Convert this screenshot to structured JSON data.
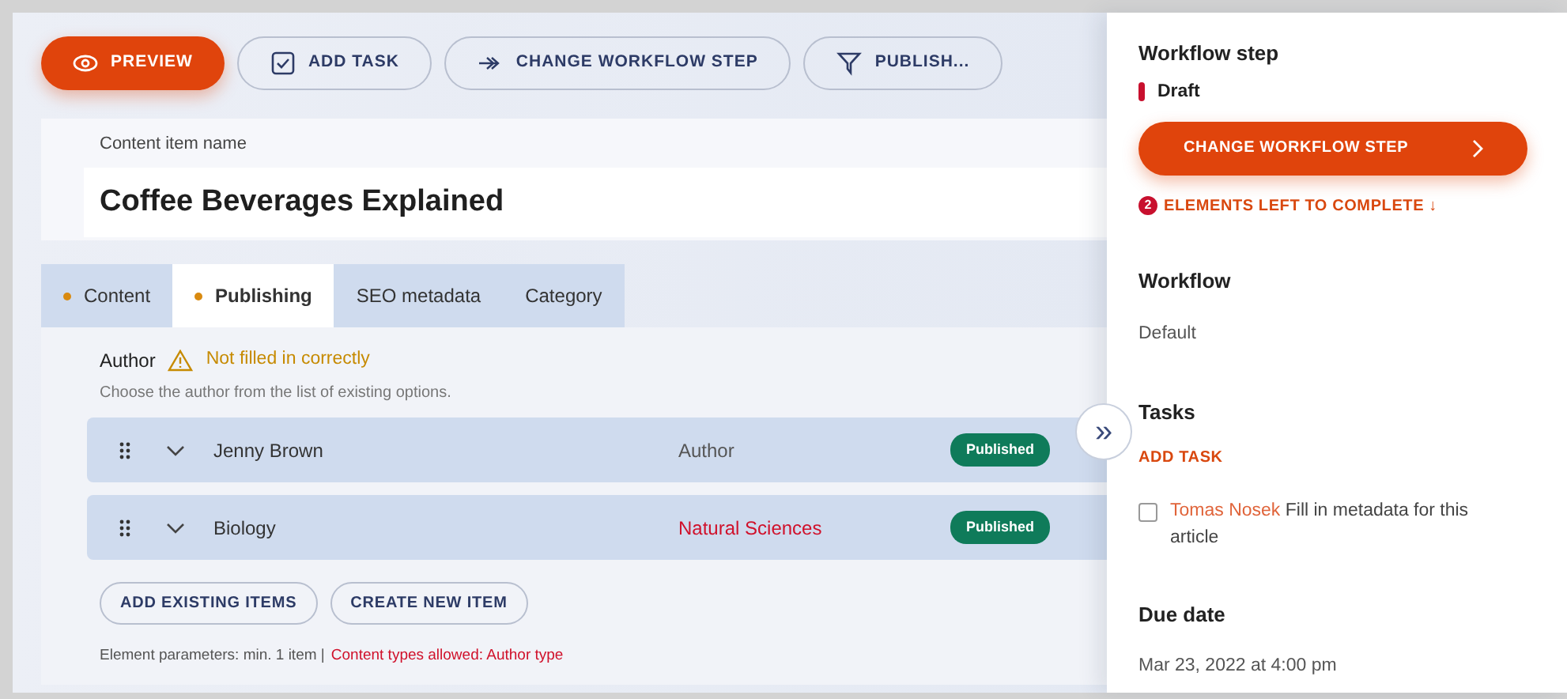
{
  "toolbar": [
    {
      "kind": "preview",
      "label": "PREVIEW"
    },
    {
      "kind": "task",
      "label": "ADD TASK"
    },
    {
      "kind": "step",
      "label": "CHANGE WORKFLOW STEP"
    },
    {
      "kind": "publish",
      "label": "PUBLISH..."
    }
  ],
  "name_field": {
    "label": "Content item name",
    "value": "Coffee Beverages Explained"
  },
  "tabs": [
    {
      "label": "Content",
      "selected": false,
      "dot": true
    },
    {
      "label": "Publishing",
      "selected": true,
      "dot": true
    },
    {
      "label": "SEO metadata",
      "selected": false,
      "dot": false
    },
    {
      "label": "Category",
      "selected": false,
      "dot": false
    }
  ],
  "element": {
    "label": "Author",
    "warning": "Not filled in correctly",
    "hint": "Choose the author from the list of existing options.",
    "items": [
      {
        "name": "Jenny Brown",
        "type": "Author",
        "type_invalid": false,
        "status": "Published"
      },
      {
        "name": "Biology",
        "type": "Natural Sciences",
        "type_invalid": true,
        "status": "Published"
      }
    ],
    "buttons": [
      "ADD EXISTING ITEMS",
      "CREATE NEW ITEM"
    ],
    "params": "Element parameters: min. 1 item |",
    "params_error": "Content types allowed: Author type"
  },
  "sidebar": {
    "step_heading": "Workflow step",
    "step": {
      "name": "Draft",
      "color": "#c8102e"
    },
    "change_button": "CHANGE WORKFLOW STEP",
    "left_count": "2",
    "left_text": "ELEMENTS LEFT TO COMPLETE ↓",
    "workflow_heading": "Workflow",
    "workflow": "Default",
    "tasks_heading": "Tasks",
    "add_task": "ADD TASK",
    "tasks": [
      {
        "assignee": "Tomas Nosek",
        "text": "Fill in metadata for this article",
        "checked": false
      }
    ],
    "due_heading": "Due date",
    "due": "Mar 23, 2022 at 4:00 pm"
  },
  "collapse_button": "»"
}
